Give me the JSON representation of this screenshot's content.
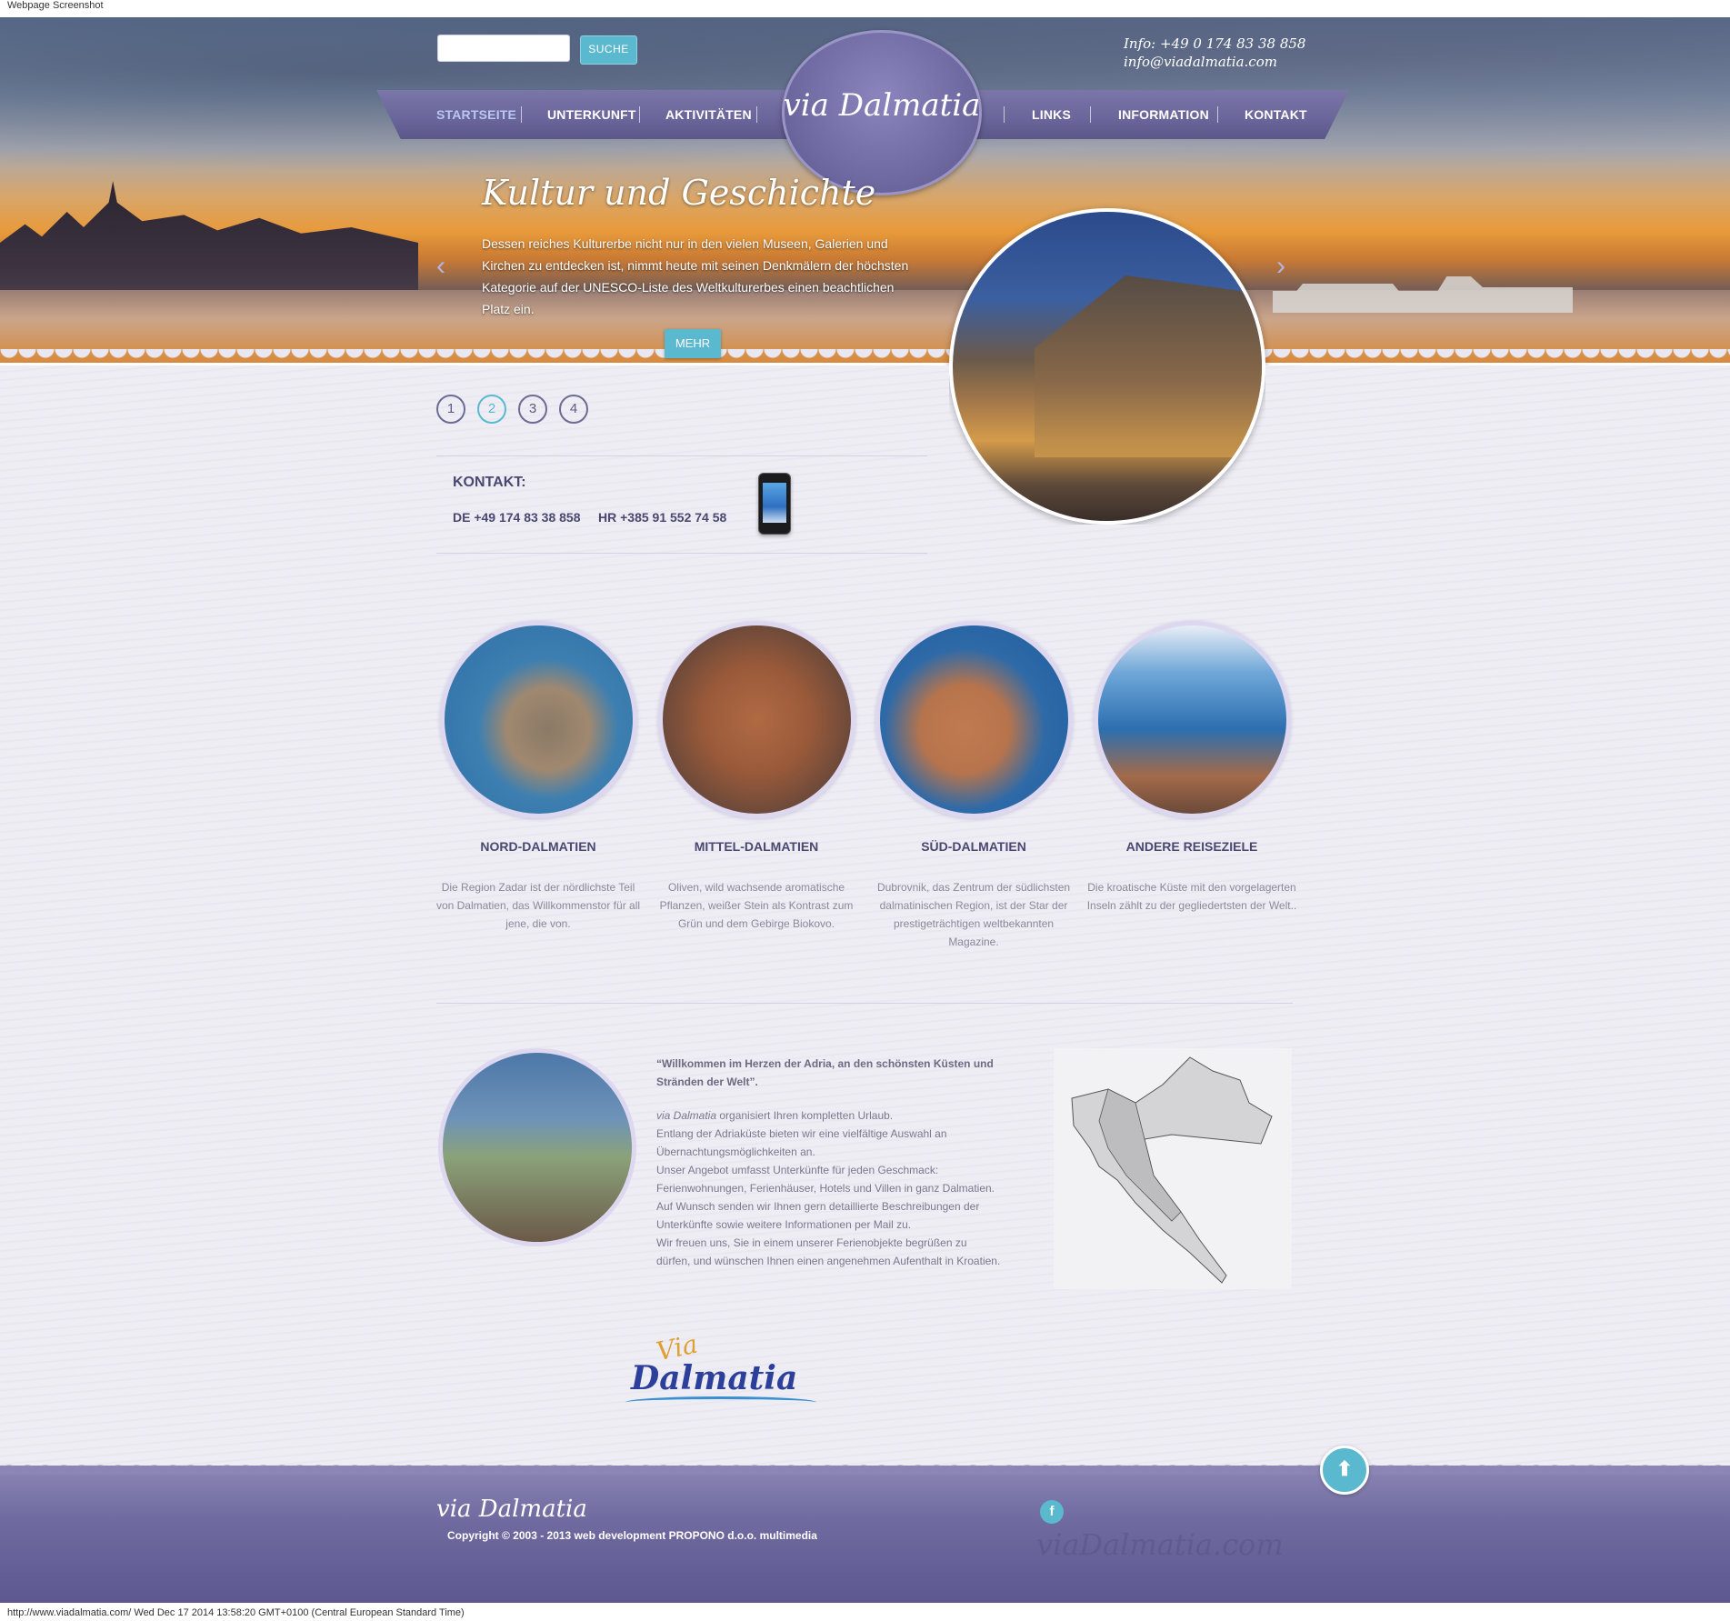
{
  "screenshot_caption": "Webpage Screenshot",
  "footer_caption": "http://www.viadalmatia.com/ Wed Dec 17 2014 13:58:20 GMT+0100 (Central European Standard Time)",
  "search": {
    "placeholder": "",
    "button_label": "SUCHE"
  },
  "header_info": {
    "phone": "Info: +49 0 174 83 38 858",
    "email": "info@viadalmatia.com"
  },
  "logo": {
    "text": "via Dalmatia"
  },
  "nav": {
    "items": [
      {
        "label": "STARTSEITE",
        "active": true
      },
      {
        "label": "UNTERKUNFT",
        "active": false
      },
      {
        "label": "AKTIVITÄTEN",
        "active": false
      },
      {
        "label": "LINKS",
        "active": false
      },
      {
        "label": "INFORMATION",
        "active": false
      },
      {
        "label": "KONTAKT",
        "active": false
      }
    ]
  },
  "slider": {
    "title": "Kultur und Geschichte",
    "text": "Dessen reiches Kulturerbe nicht nur in den vielen Museen, Galerien und Kirchen zu entdecken ist, nimmt heute mit seinen Denkmälern der höchsten Kategorie auf der UNESCO-Liste des Weltkulturerbes einen beachtlichen Platz ein.",
    "more_label": "MEHR",
    "pages": [
      "1",
      "2",
      "3",
      "4"
    ],
    "active_page": "2"
  },
  "contact": {
    "title": "KONTAKT:",
    "de": "DE +49 174 83 38 858",
    "hr": "HR +385 91 552 74 58"
  },
  "regions": [
    {
      "title": "NORD-DALMATIEN",
      "text": "Die Region Zadar ist der nördlichste Teil von Dalmatien, das Willkommenstor für all jene, die von."
    },
    {
      "title": "MITTEL-DALMATIEN",
      "text": "Oliven, wild wachsende aromatische Pflanzen, weißer Stein als Kontrast zum Grün und dem Gebirge Biokovo."
    },
    {
      "title": "SÜD-DALMATIEN",
      "text": "Dubrovnik, das Zentrum der südlichsten dalmatinischen Region, ist der Star der prestigeträchtigen weltbekannten Magazine."
    },
    {
      "title": "ANDERE REISEZIELE",
      "text": "Die kroatische Küste mit den vorgelagerten Inseln zählt zu der gegliedertsten der Welt.."
    }
  ],
  "about": {
    "quote": "“Willkommen im Herzen der Adria, an den schönsten Küsten und Stränden der Welt”.",
    "brand": "via Dalmatia",
    "lines": [
      " organisiert Ihren kompletten Urlaub.",
      "Entlang der Adriaküste bieten wir eine vielfältige Auswahl an Übernachtungsmöglichkeiten an.",
      "Unser Angebot umfasst Unterkünfte für jeden Geschmack: Ferienwohnungen, Ferienhäuser, Hotels und Villen in ganz Dalmatien.",
      "Auf Wunsch senden wir Ihnen gern detaillierte Beschreibungen der Unterkünfte sowie weitere Informationen per Mail zu.",
      "Wir freuen uns, Sie in einem unserer Ferienobjekte begrüßen zu dürfen, und wünschen Ihnen einen angenehmen Aufenthalt in Kroatien."
    ]
  },
  "brand_logo": {
    "via": "Via",
    "dalmatia": "Dalmatia"
  },
  "footer": {
    "logo": "via Dalmatia",
    "copyright": "Copyright © 2003 - 2013 web development PROPONO d.o.o. multimedia",
    "watermark": "viaDalmatia.com",
    "facebook_icon": "f",
    "top_icon": "⬆"
  },
  "colors": {
    "accent": "#5ab9cf",
    "nav": "#6a659a",
    "text_dark": "#4c4770"
  }
}
